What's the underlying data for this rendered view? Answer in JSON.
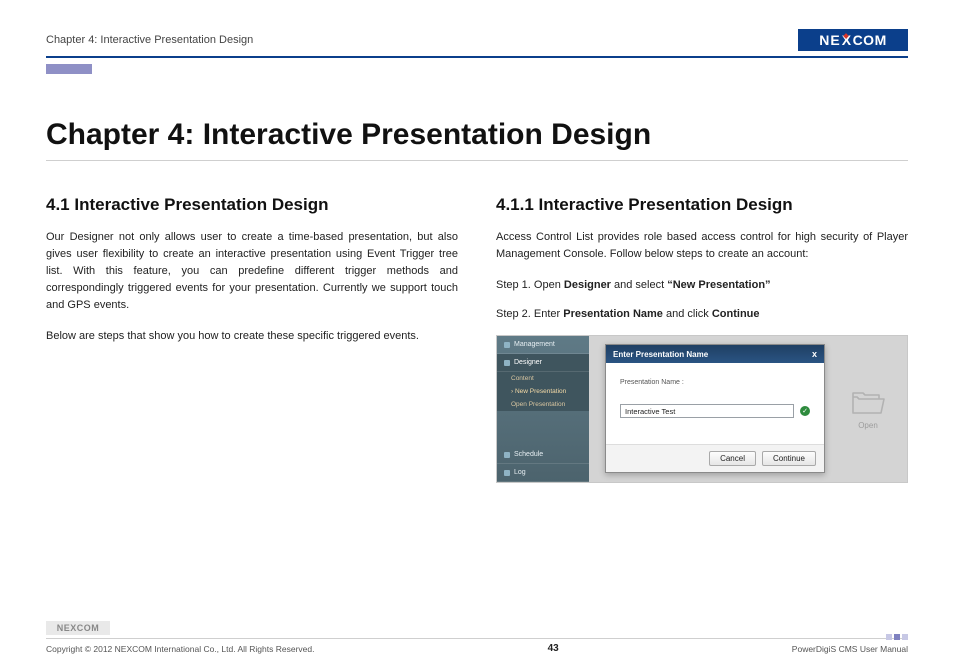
{
  "header": {
    "breadcrumb": "Chapter 4: Interactive Presentation Design",
    "logo_text_1": "NE",
    "logo_text_x": "X",
    "logo_text_2": "COM"
  },
  "title": "Chapter 4: Interactive Presentation Design",
  "left": {
    "heading": "4.1 Interactive Presentation Design",
    "p1": "Our Designer not only allows user to create a time-based presentation, but also gives user flexibility to create an interactive presentation using Event Trigger tree list. With this feature, you can predefine different trigger methods and correspondingly triggered events for your presentation. Currently we support touch and GPS events.",
    "p2": "Below are steps that show you how to create these specific triggered events."
  },
  "right": {
    "heading": "4.1.1 Interactive Presentation Design",
    "intro": "Access Control List provides role based access control for high security of Player Management Console. Follow below steps to create an account:",
    "step1_pre": "Step 1. Open ",
    "step1_b1": "Designer",
    "step1_mid": " and select ",
    "step1_b2": "“New Presentation”",
    "step2_pre": "Step 2. Enter ",
    "step2_b1": "Presentation Name",
    "step2_mid": " and click ",
    "step2_b2": "Continue"
  },
  "shot": {
    "sidebar": {
      "management": "Management",
      "designer": "Designer",
      "content": "Content",
      "new_presentation": "› New Presentation",
      "open_presentation": "Open Presentation",
      "schedule": "Schedule",
      "log": "Log"
    },
    "dialog": {
      "title": "Enter Presentation Name",
      "close": "x",
      "field_label": "Presentation Name :",
      "field_value": "Interactive Test",
      "cancel": "Cancel",
      "continue": "Continue"
    },
    "open_label": "Open"
  },
  "footer": {
    "logo": "NEXCOM",
    "copyright": "Copyright © 2012 NEXCOM International Co., Ltd. All Rights Reserved.",
    "page": "43",
    "manual": "PowerDigiS CMS User Manual"
  }
}
